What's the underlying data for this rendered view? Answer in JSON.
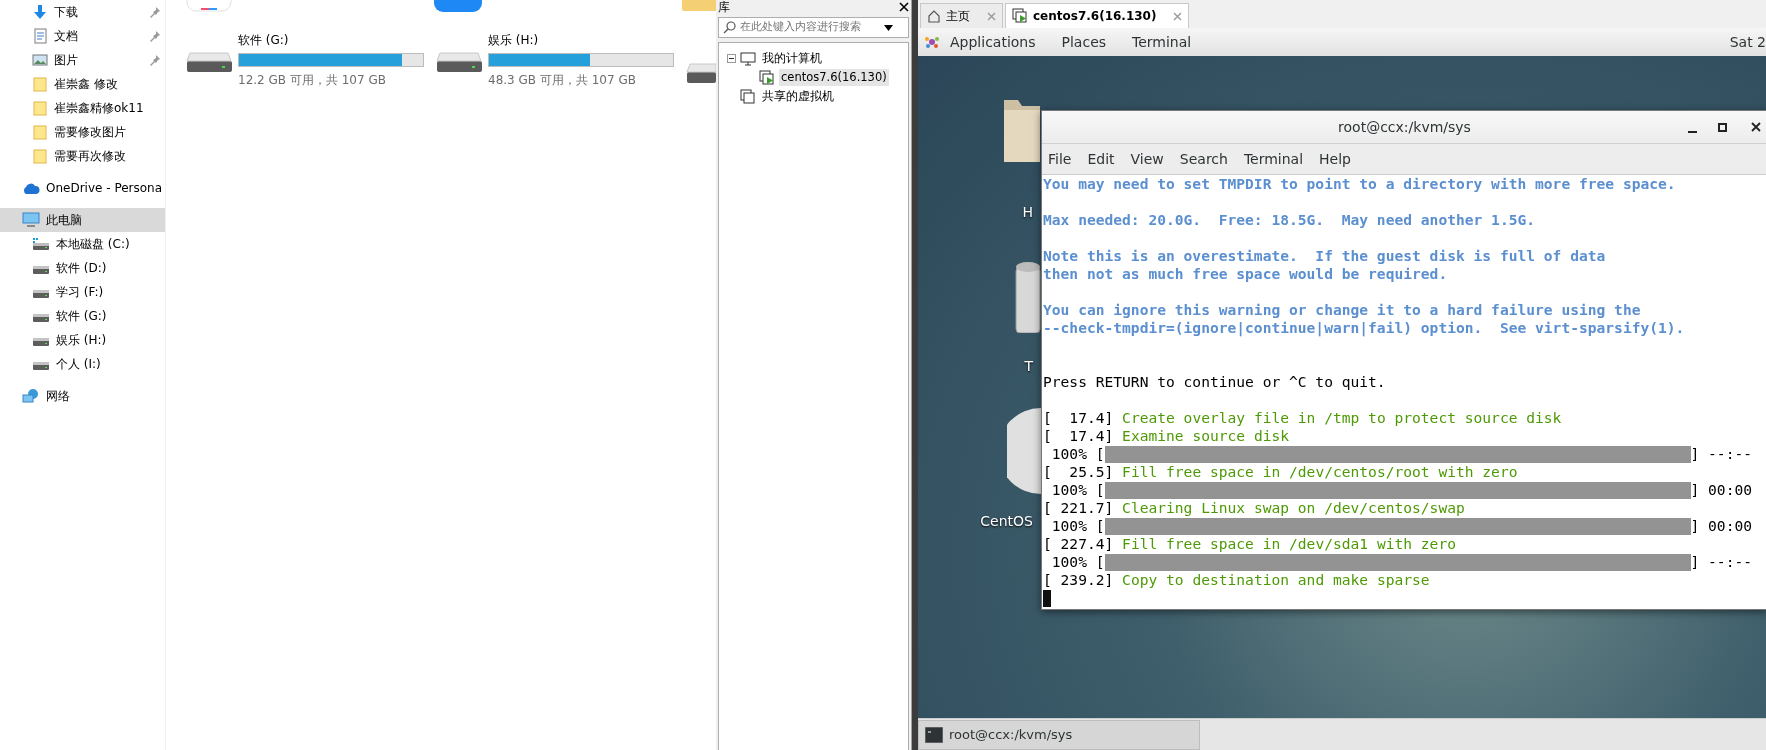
{
  "explorer": {
    "nav_items": [
      {
        "label": "下载",
        "kind": "download",
        "pinned": true,
        "selected": false
      },
      {
        "label": "文档",
        "kind": "document",
        "pinned": true,
        "selected": false
      },
      {
        "label": "图片",
        "kind": "picture",
        "pinned": true,
        "selected": false
      },
      {
        "label": "崔崇鑫 修改",
        "kind": "folder",
        "pinned": false,
        "selected": false
      },
      {
        "label": "崔崇鑫精修ok11",
        "kind": "folder",
        "pinned": false,
        "selected": false
      },
      {
        "label": "需要修改图片",
        "kind": "folder",
        "pinned": false,
        "selected": false
      },
      {
        "label": "需要再次修改",
        "kind": "folder",
        "pinned": false,
        "selected": false
      },
      {
        "label": "OneDrive - Persona",
        "kind": "cloud",
        "pinned": false,
        "selected": false
      },
      {
        "label": "此电脑",
        "kind": "computer",
        "pinned": false,
        "selected": true,
        "children": [
          {
            "label": "本地磁盘 (C:)",
            "kind": "system-drive",
            "pinned": false,
            "selected": false
          },
          {
            "label": "软件 (D:)",
            "kind": "drive",
            "pinned": false,
            "selected": false
          },
          {
            "label": "学习 (F:)",
            "kind": "drive",
            "pinned": false,
            "selected": false
          },
          {
            "label": "软件 (G:)",
            "kind": "drive",
            "pinned": false,
            "selected": false
          },
          {
            "label": "娱乐 (H:)",
            "kind": "drive",
            "pinned": false,
            "selected": false
          },
          {
            "label": "个人 (I:)",
            "kind": "drive",
            "pinned": false,
            "selected": false
          }
        ]
      },
      {
        "label": "网络",
        "kind": "network",
        "pinned": false,
        "selected": false
      }
    ],
    "drives": [
      {
        "name": "软件 (G:)",
        "level": 0.886,
        "caption": "12.2 GB 可用，共 107 GB"
      },
      {
        "name": "娱乐 (H:)",
        "level": 0.549,
        "caption": "48.3 GB 可用，共 107 GB"
      }
    ]
  },
  "library": {
    "title": "库",
    "search": {
      "placeholder": "在此处键入内容进行搜索"
    },
    "tree": [
      {
        "label": "我的计算机",
        "kind": "computer",
        "expanded": true,
        "selected": false,
        "children": [
          {
            "label": "centos7.6(16.130)",
            "kind": "vm",
            "selected": true
          }
        ]
      },
      {
        "label": "共享的虚拟机",
        "kind": "shared",
        "selected": false
      }
    ]
  },
  "tabs": [
    {
      "label": "主页",
      "kind": "home",
      "selected": false
    },
    {
      "label": "centos7.6(16.130)",
      "kind": "vm",
      "selected": true
    }
  ],
  "topbar": {
    "menus": [
      "Applications",
      "Places",
      "Terminal"
    ],
    "clock": "Sat 2"
  },
  "desktop_icons": [
    {
      "label": "H",
      "kind": "folder"
    },
    {
      "label": "T",
      "kind": "trash"
    },
    {
      "label": "CentOS",
      "kind": "disc"
    }
  ],
  "terminal": {
    "title": "root@ccx:/kvm/sys",
    "menus": [
      "File",
      "Edit",
      "View",
      "Search",
      "Terminal",
      "Help"
    ],
    "lines": [
      {
        "kind": "info",
        "text": "You may need to set TMPDIR to point to a directory with more free space."
      },
      {
        "kind": "blank"
      },
      {
        "kind": "info",
        "text": "Max needed: 20.0G.  Free: 18.5G.  May need another 1.5G."
      },
      {
        "kind": "blank"
      },
      {
        "kind": "info",
        "text": "Note this is an overestimate.  If the guest disk is full of data"
      },
      {
        "kind": "info",
        "text": "then not as much free space would be required."
      },
      {
        "kind": "blank"
      },
      {
        "kind": "info",
        "text": "You can ignore this warning or change it to a hard failure using the"
      },
      {
        "kind": "info",
        "text": "--check-tmpdir=(ignore|continue|warn|fail) option.  See virt-sparsify(1)."
      },
      {
        "kind": "blank"
      },
      {
        "kind": "blank"
      },
      {
        "kind": "plain",
        "text": "Press RETURN to continue or ^C to quit."
      },
      {
        "kind": "blank"
      },
      {
        "kind": "step",
        "time": "[  17.4]",
        "text": "Create overlay file in /tmp to protect source disk"
      },
      {
        "kind": "step",
        "time": "[  17.4]",
        "text": "Examine source disk"
      },
      {
        "kind": "progress",
        "prefix": " 100% [",
        "level": 1,
        "suffix": "] --:--"
      },
      {
        "kind": "step",
        "time": "[  25.5]",
        "text": "Fill free space in /dev/centos/root with zero"
      },
      {
        "kind": "progress",
        "prefix": " 100% [",
        "level": 1,
        "suffix": "] 00:00"
      },
      {
        "kind": "step",
        "time": "[ 221.7]",
        "text": "Clearing Linux swap on /dev/centos/swap"
      },
      {
        "kind": "progress",
        "prefix": " 100% [",
        "level": 1,
        "suffix": "] 00:00"
      },
      {
        "kind": "step",
        "time": "[ 227.4]",
        "text": "Fill free space in /dev/sda1 with zero"
      },
      {
        "kind": "progress",
        "prefix": " 100% [",
        "level": 1,
        "suffix": "] --:--"
      },
      {
        "kind": "step",
        "time": "[ 239.2]",
        "text": "Copy to destination and make sparse"
      },
      {
        "kind": "cursor"
      }
    ]
  },
  "taskbar": {
    "items": [
      {
        "label": "root@ccx:/kvm/sys"
      }
    ]
  }
}
